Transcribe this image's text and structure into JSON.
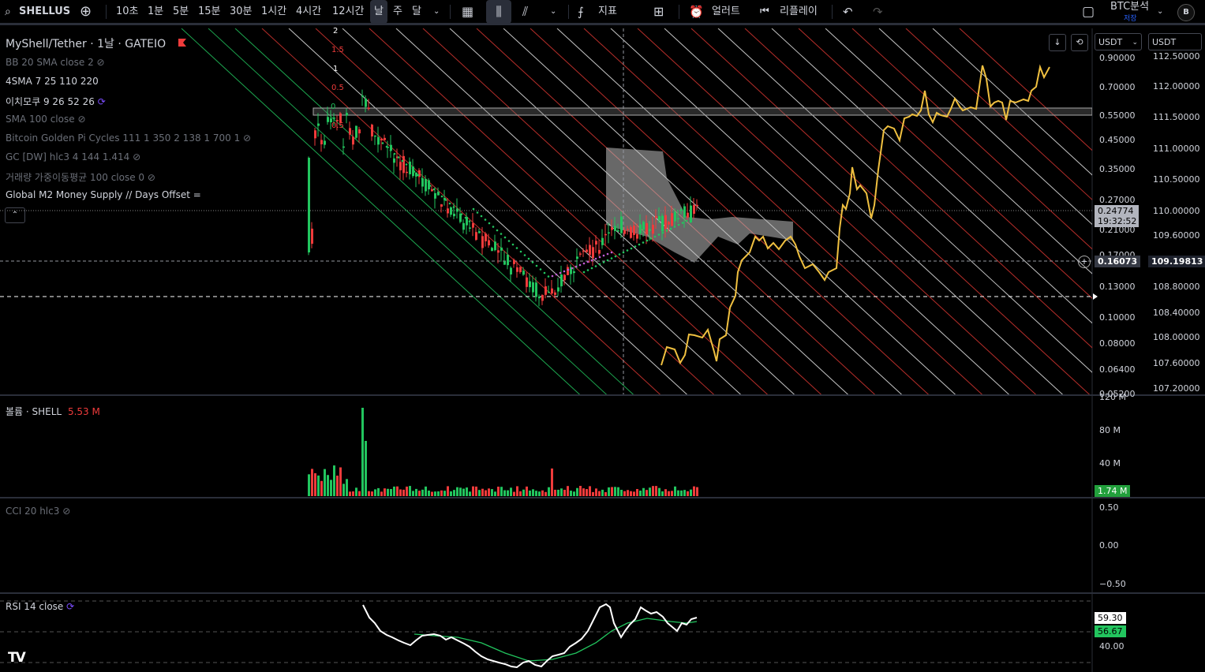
{
  "toolbar": {
    "symbol": "SHELLUS",
    "intervals": [
      "10초",
      "1분",
      "5분",
      "15분",
      "30분",
      "1시간",
      "4시간",
      "12시간",
      "날",
      "주",
      "달"
    ],
    "indicators_label": "지표",
    "alert_label": "얼러트",
    "replay_label": "리플레이",
    "layout_name": "BTC분석",
    "layout_status": "저장",
    "avatar_letter": "B"
  },
  "chart": {
    "title": "MyShell/Tether · 1날 · GATEIO",
    "currency_left": "USDT",
    "currency_right": "USDT",
    "indicators": [
      {
        "label": "BB 20 SMA close 2",
        "hidden": true
      },
      {
        "label": "4SMA 7 25 110 220",
        "hidden": false
      },
      {
        "label": "이치모쿠 9 26 52 26",
        "hidden": false
      },
      {
        "label": "SMA 100 close",
        "hidden": true
      },
      {
        "label": "Bitcoin Golden Pi Cycles 111 1 350 2 138 1 700 1",
        "hidden": true
      },
      {
        "label": "GC [DW] hlc3 4 144 1.414",
        "hidden": true
      },
      {
        "label": "거래량 가중이동평균 100 close 0",
        "hidden": true
      },
      {
        "label": "Global M2 Money Supply // Days Offset =",
        "hidden": false
      }
    ],
    "fib_labels": [
      "2",
      "1.5",
      "1",
      "0.5",
      "0",
      "0.5"
    ],
    "price_axis_left": [
      "0.90000",
      "0.70000",
      "0.55000",
      "0.45000",
      "0.35000",
      "0.27000",
      "0.21000",
      "0.17000",
      "0.13000",
      "0.10000",
      "0.08000",
      "0.06400",
      "0.05200"
    ],
    "price_axis_right": [
      "112.50000",
      "112.00000",
      "111.50000",
      "111.00000",
      "110.50000",
      "110.00000",
      "109.60000",
      "109.19813",
      "108.80000",
      "108.40000",
      "108.00000",
      "107.60000",
      "107.20000"
    ],
    "last_price": "0.24774",
    "countdown": "19:32:52",
    "crosshair_price": "0.16073",
    "crosshair_m2": "109.19813"
  },
  "volume": {
    "label": "볼륨 · SHELL",
    "value": "5.53 M",
    "axis": [
      "120 M",
      "80 M",
      "40 M"
    ],
    "current": "1.74 M"
  },
  "cci": {
    "label": "CCI 20 hlc3",
    "axis": [
      "0.50",
      "0.00",
      "−0.50"
    ]
  },
  "rsi": {
    "label": "RSI 14 close",
    "value": "59.30",
    "ma_value": "56.67",
    "axis": [
      "40.00"
    ]
  },
  "colors": {
    "up": "#26a69a",
    "green": "#22c55e",
    "red": "#ef3b3b",
    "m2": "#f0c040",
    "rsi_ma": "#22c55e"
  }
}
